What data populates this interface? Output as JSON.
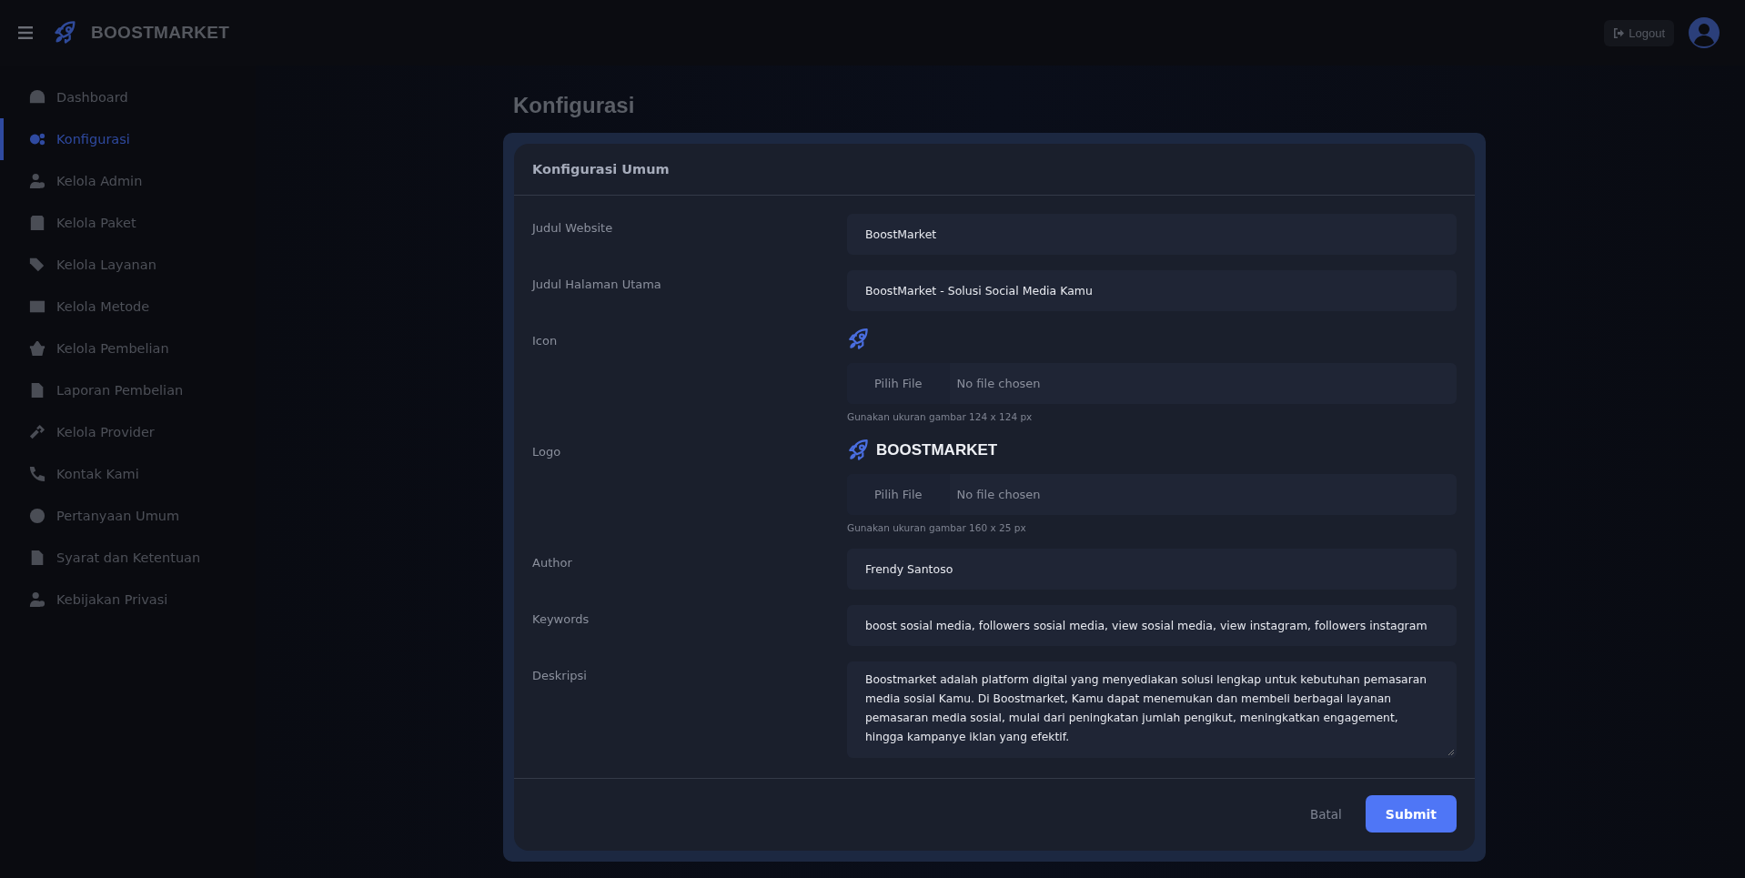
{
  "header": {
    "brand": "BOOSTMARKET",
    "logout": "Logout"
  },
  "sidebar": {
    "items": [
      {
        "label": "Dashboard",
        "selected": false
      },
      {
        "label": "Konfigurasi",
        "selected": true
      },
      {
        "label": "Kelola Admin",
        "selected": false
      },
      {
        "label": "Kelola Paket",
        "selected": false
      },
      {
        "label": "Kelola Layanan",
        "selected": false
      },
      {
        "label": "Kelola Metode",
        "selected": false
      },
      {
        "label": "Kelola Pembelian",
        "selected": false
      },
      {
        "label": "Laporan Pembelian",
        "selected": false
      },
      {
        "label": "Kelola Provider",
        "selected": false
      },
      {
        "label": "Kontak Kami",
        "selected": false
      },
      {
        "label": "Pertanyaan Umum",
        "selected": false
      },
      {
        "label": "Syarat dan Ketentuan",
        "selected": false
      },
      {
        "label": "Kebijakan Privasi",
        "selected": false
      }
    ]
  },
  "page": {
    "title": "Konfigurasi"
  },
  "form": {
    "title": "Konfigurasi Umum",
    "fields": [
      {
        "kind": "text",
        "label": "Judul Website",
        "value": "BoostMarket"
      },
      {
        "kind": "text",
        "label": "Judul Halaman Utama",
        "value": "BoostMarket - Solusi Social Media Kamu"
      },
      {
        "kind": "file",
        "label": "Icon",
        "button": "Pilih File",
        "status": "No file chosen",
        "hint": "Gunakan ukuran gambar 124 x 124 px"
      },
      {
        "kind": "file",
        "label": "Logo",
        "preview_text": "BOOSTMARKET",
        "button": "Pilih File",
        "status": "No file chosen",
        "hint": "Gunakan ukuran gambar 160 x 25 px"
      },
      {
        "kind": "text",
        "label": "Author",
        "value": "Frendy Santoso"
      },
      {
        "kind": "text",
        "label": "Keywords",
        "value": "boost sosial media, followers sosial media, view sosial media, view instagram, followers instagram"
      },
      {
        "kind": "textarea",
        "label": "Deskripsi",
        "value": "Boostmarket adalah platform digital yang menyediakan solusi lengkap untuk kebutuhan pemasaran media sosial Kamu. Di Boostmarket, Kamu dapat menemukan dan membeli berbagai layanan pemasaran media sosial, mulai dari peningkatan jumlah pengikut, meningkatkan engagement, hingga kampanye iklan yang efektif."
      }
    ],
    "cancel": "Batal",
    "submit": "Submit"
  }
}
